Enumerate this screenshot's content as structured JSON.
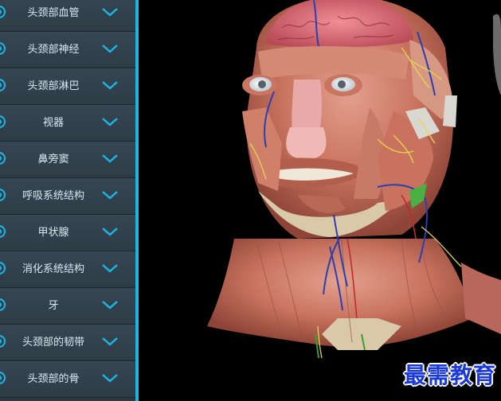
{
  "sidebar": {
    "items": [
      {
        "label": "头颈部血管"
      },
      {
        "label": "头颈部神经"
      },
      {
        "label": "头颈部淋巴"
      },
      {
        "label": "视器"
      },
      {
        "label": "鼻旁窦"
      },
      {
        "label": "呼吸系统结构"
      },
      {
        "label": "甲状腺"
      },
      {
        "label": "消化系统结构"
      },
      {
        "label": "牙"
      },
      {
        "label": "头颈部的韧带"
      },
      {
        "label": "头颈部的骨"
      }
    ]
  },
  "viewport": {
    "model_icon": "head-neck-anatomy-model",
    "watermark": "最需教育"
  },
  "colors": {
    "accent": "#19b6e6",
    "sidebar_bg": "#2c3a44",
    "watermark": "#1a39d6"
  }
}
